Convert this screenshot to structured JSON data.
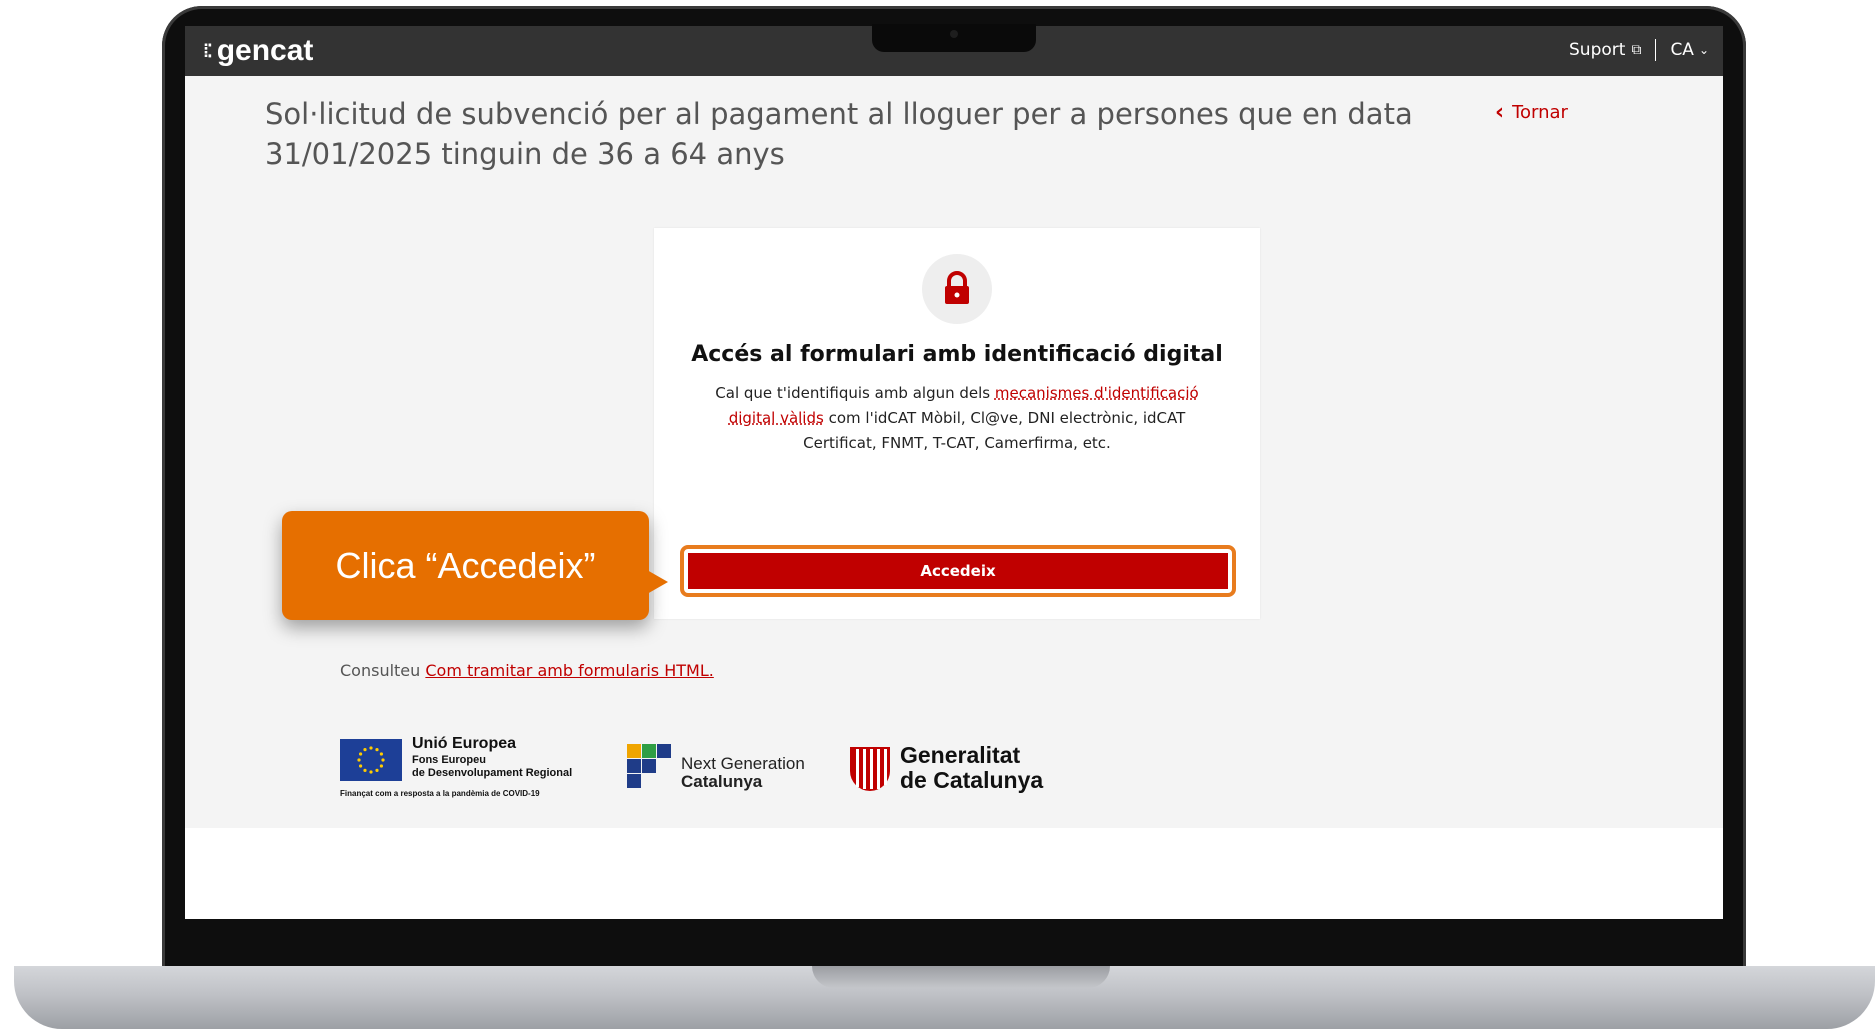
{
  "header": {
    "logo_text": "gencat",
    "support_label": "Suport",
    "language_label": "CA"
  },
  "page": {
    "title": "Sol·licitud de subvenció per al pagament al lloguer per a persones que en data 31/01/2025 tinguin de 36 a 64 anys",
    "back_label": "Tornar"
  },
  "card": {
    "title": "Accés al formulari amb identificació digital",
    "desc_before": "Cal que t'identifiquis amb algun dels ",
    "desc_link": "mecanismes d'identificació digital vàlids",
    "desc_after": " com l'idCAT Mòbil, Cl@ve, DNI electrònic, idCAT Certificat, FNMT, T-CAT, Camerfirma, etc.",
    "button_label": "Accedeix"
  },
  "consult": {
    "prefix": "Consulteu ",
    "link": "Com tramitar amb formularis HTML."
  },
  "logos": {
    "eu_line1": "Unió Europea",
    "eu_line2": "Fons Europeu",
    "eu_line3": "de Desenvolupament Regional",
    "eu_footnote": "Finançat com a resposta a la pandèmia de COVID-19",
    "ng_line1": "Next Generation",
    "ng_line2": "Catalunya",
    "gen_line1": "Generalitat",
    "gen_line2": "de Catalunya"
  },
  "callout": {
    "text": "Clica “Accedeix”"
  },
  "colors": {
    "accent_red": "#c00000",
    "callout_orange": "#e66f00",
    "topbar": "#333333"
  }
}
